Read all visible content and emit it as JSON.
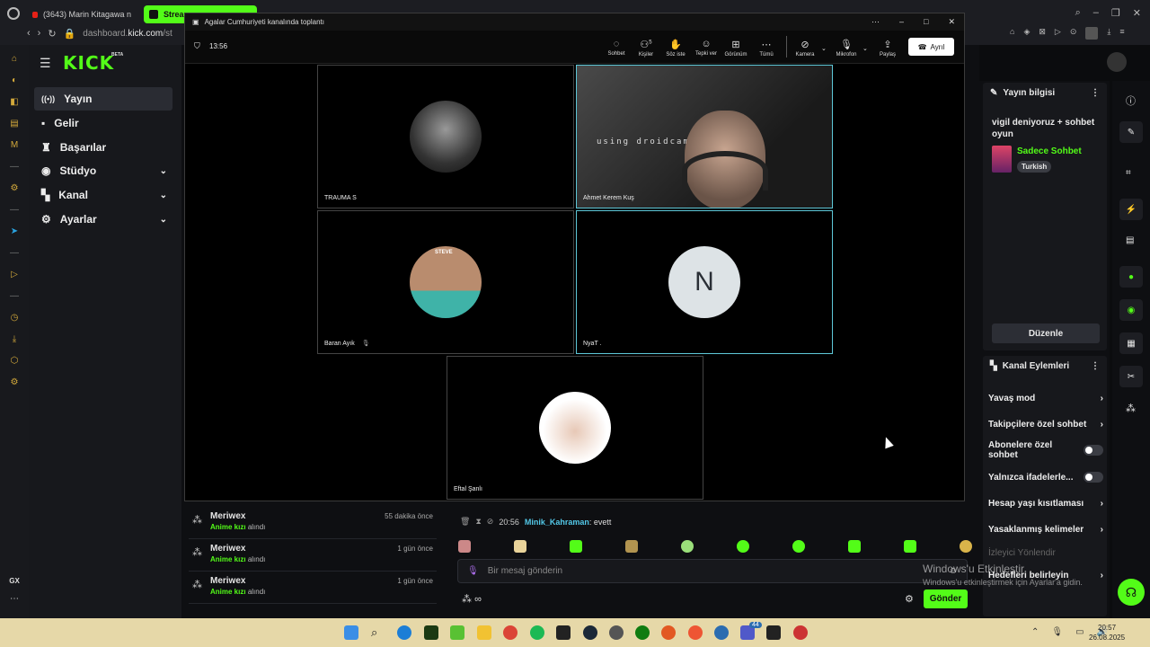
{
  "browser": {
    "tabs": [
      {
        "label": "(3643) Marin Kitagawa n"
      },
      {
        "label": "Stream"
      }
    ],
    "address_host": "dashboard.",
    "address_domain": "kick.com",
    "address_rest": "/st"
  },
  "kick": {
    "logo": "KICK",
    "logo_badge": "BETA",
    "nav": [
      {
        "label": "Yayın"
      },
      {
        "label": "Gelir"
      },
      {
        "label": "Başarılar"
      },
      {
        "label": "Stüdyo"
      },
      {
        "label": "Kanal"
      },
      {
        "label": "Ayarlar"
      }
    ],
    "gx_label": "GX"
  },
  "teams": {
    "window_title": "Agalar Cumhuriyeti kanalında toplantı",
    "timer": "13:56",
    "toolbar": [
      {
        "label": "Sohbet",
        "icon": "chat-icon"
      },
      {
        "label": "Kişiler",
        "icon": "people-icon",
        "badge": "5"
      },
      {
        "label": "Söz iste",
        "icon": "hand-icon"
      },
      {
        "label": "Tepki ver",
        "icon": "emoji-icon"
      },
      {
        "label": "Görünüm",
        "icon": "layout-icon"
      },
      {
        "label": "Tümü",
        "icon": "more-icon"
      },
      {
        "label": "Kamera",
        "icon": "camera-off-icon"
      },
      {
        "label": "Mikrofon",
        "icon": "mic-icon"
      },
      {
        "label": "Paylaş",
        "icon": "share-icon"
      }
    ],
    "leave_label": "Ayrıl",
    "participants": [
      {
        "name": "TRAUMA S"
      },
      {
        "name": "Ahmet Kerem Kuş",
        "overlay": "using droidcam.app"
      },
      {
        "name": "Baran Ayık",
        "avatar_text": "STEVE"
      },
      {
        "name": "NyaT .",
        "initial": "N"
      },
      {
        "name": "Eftal Şanlı"
      }
    ]
  },
  "info_panel": {
    "title": "Yayın bilgisi",
    "stream_title": "vigil deniyoruz + sohbet oyun",
    "category": "Sadece Sohbet",
    "language": "Turkish",
    "edit_label": "Düzenle"
  },
  "actions_panel": {
    "title": "Kanal Eylemleri",
    "items": [
      {
        "label": "Yavaş mod",
        "ctrl": "›"
      },
      {
        "label": "Takipçilere özel sohbet",
        "ctrl": "›"
      },
      {
        "label": "Abonelere özel sohbet",
        "ctrl": "toggle"
      },
      {
        "label": "Yalnızca ifadelerle...",
        "ctrl": "toggle"
      },
      {
        "label": "Hesap yaşı kısıtlaması",
        "ctrl": "›"
      },
      {
        "label": "Yasaklanmış kelimeler",
        "ctrl": "›"
      },
      {
        "label": "İzleyici Yönlendir",
        "ctrl": ""
      },
      {
        "label": "Hedefleri belirleyin",
        "ctrl": "›"
      }
    ]
  },
  "chat": {
    "partial_user": "Minik_Kahraman:",
    "msg_time": "20:56",
    "msg_user": "Minik_Kahraman",
    "msg_text": ": evett",
    "input_placeholder": "Bir mesaj gönderin",
    "send_label": "Gönder"
  },
  "log": [
    {
      "user": "Meriwex",
      "item": "Anime kızı",
      "suffix": "alındı",
      "time": "55 dakika önce"
    },
    {
      "user": "Meriwex",
      "item": "Anime kızı",
      "suffix": "alındı",
      "time": "1 gün önce"
    },
    {
      "user": "Meriwex",
      "item": "Anime kızı",
      "suffix": "alındı",
      "time": "1 gün önce"
    }
  ],
  "watermark": {
    "line1": "Windows'u Etkinleştir",
    "line2": "Windows'u etkinleştirmek için Ayarlar'a gidin."
  },
  "taskbar": {
    "time": "20:57",
    "date": "26.08.2025",
    "teams_badge": "44"
  },
  "colors": {
    "kick_green": "#53fc18",
    "active_tile": "#5ec8d8",
    "taskbar": "#e6d8a8"
  }
}
